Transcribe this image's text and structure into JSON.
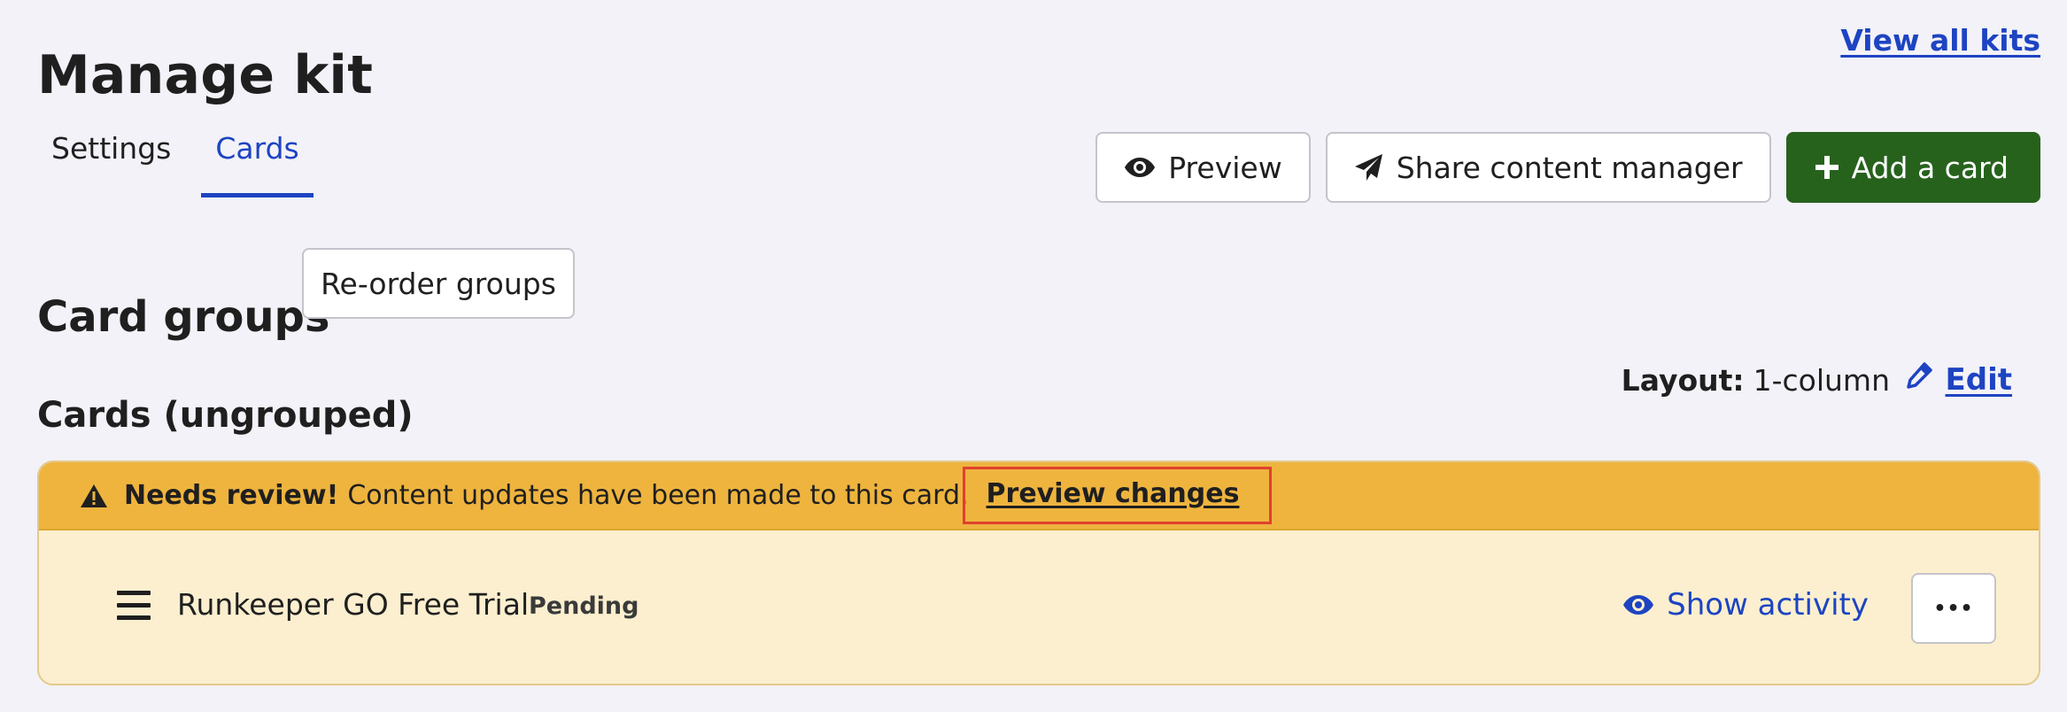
{
  "header": {
    "title": "Manage kit",
    "view_all_link": "View all kits"
  },
  "tabs": [
    {
      "label": "Settings",
      "active": false
    },
    {
      "label": "Cards",
      "active": true
    }
  ],
  "toolbar": {
    "preview_label": "Preview",
    "share_label": "Share content manager",
    "add_card_label": "Add a card"
  },
  "card_groups": {
    "title": "Card groups",
    "reorder_label": "Re-order groups"
  },
  "ungrouped": {
    "title": "Cards (ungrouped)",
    "layout_label": "Layout:",
    "layout_value": "1-column",
    "edit_label": "Edit"
  },
  "card": {
    "alert_strong": "Needs review!",
    "alert_text": "Content updates have been made to this card.",
    "alert_link": "Preview changes",
    "name": "Runkeeper GO Free Trial",
    "status": "Pending",
    "show_activity_label": "Show activity",
    "more_label": "•••"
  },
  "colors": {
    "accent_blue": "#1d44c2",
    "primary_green": "#27621d",
    "alert_yellow": "#eeb43e",
    "card_bg": "#fcefcf",
    "highlight_red": "#e0412e"
  },
  "icons": [
    "eye-icon",
    "paper-plane-icon",
    "plus-icon",
    "pencil-icon",
    "warning-icon",
    "hamburger-icon",
    "ellipsis-icon"
  ]
}
